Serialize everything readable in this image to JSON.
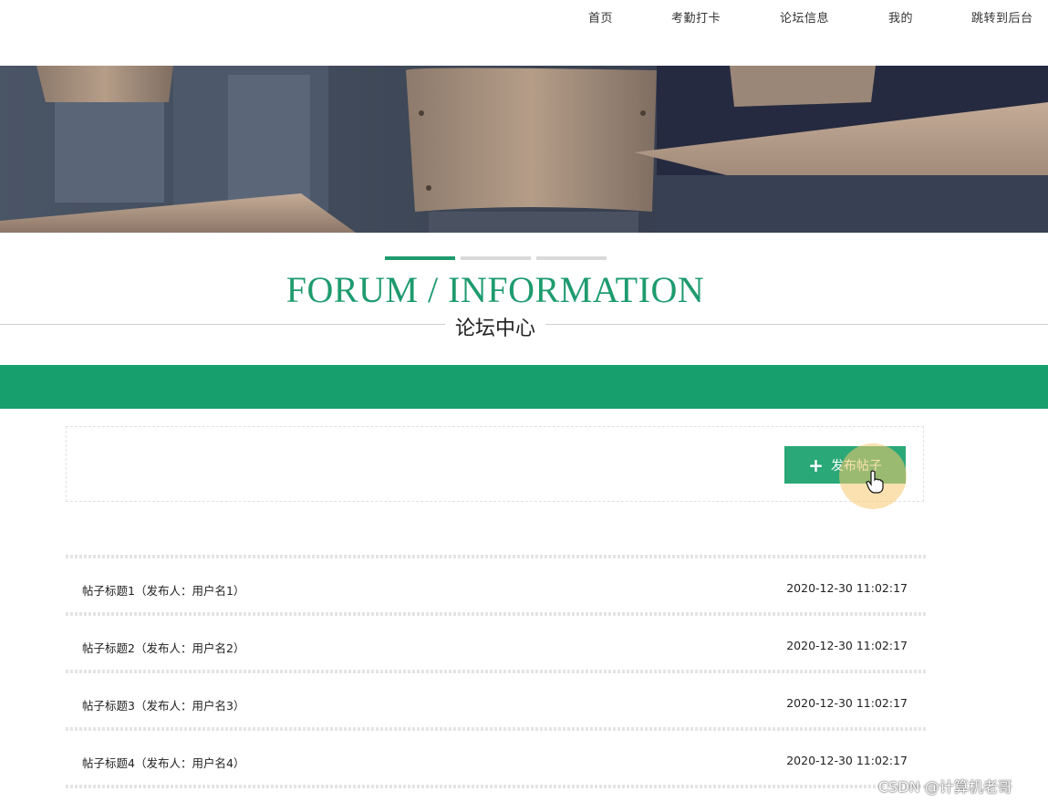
{
  "nav": {
    "items": [
      {
        "label": "首页"
      },
      {
        "label": "考勤打卡"
      },
      {
        "label": "论坛信息"
      },
      {
        "label": "我的"
      },
      {
        "label": "跳转到后台"
      }
    ]
  },
  "section": {
    "en_title": "FORUM / INFORMATION",
    "cn_title": "论坛中心"
  },
  "actions": {
    "publish_label": "发布帖子",
    "publish_icon": "plus-icon"
  },
  "posts": [
    {
      "title": "帖子标题1（发布人：用户名1）",
      "time": "2020-12-30 11:02:17"
    },
    {
      "title": "帖子标题2（发布人：用户名2）",
      "time": "2020-12-30 11:02:17"
    },
    {
      "title": "帖子标题3（发布人：用户名3）",
      "time": "2020-12-30 11:02:17"
    },
    {
      "title": "帖子标题4（发布人：用户名4）",
      "time": "2020-12-30 11:02:17"
    }
  ],
  "watermark": "CSDN @计算机老哥",
  "colors": {
    "accent": "#1e9b6e",
    "strip": "#17a06d",
    "button": "#2aa877",
    "bar_inactive": "#d9d9d9"
  }
}
